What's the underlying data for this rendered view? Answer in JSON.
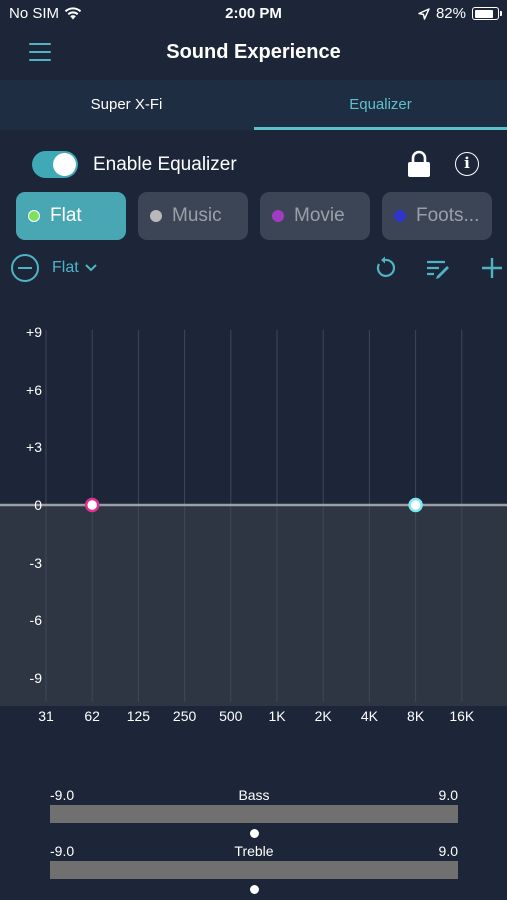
{
  "status_bar": {
    "carrier": "No SIM",
    "time": "2:00 PM",
    "battery_percent_text": "82%",
    "battery_level": 0.82,
    "icons": [
      "wifi-icon",
      "location-arrow-icon",
      "battery-icon"
    ]
  },
  "nav": {
    "title": "Sound Experience",
    "menu_icon": "hamburger-menu-icon"
  },
  "tabs": [
    {
      "label": "Super X-Fi",
      "active": false
    },
    {
      "label": "Equalizer",
      "active": true
    }
  ],
  "equalizer": {
    "enable_label": "Enable Equalizer",
    "enabled": true,
    "lock_icon": "lock-icon",
    "info_icon": "info-icon"
  },
  "presets": [
    {
      "label": "Flat",
      "dot_color": "#7ee05c",
      "active": true
    },
    {
      "label": "Music",
      "dot_color": "#b9b9b9",
      "active": false
    },
    {
      "label": "Movie",
      "dot_color": "#a23bc4",
      "active": false
    },
    {
      "label": "Foots...",
      "dot_color": "#2f35c9",
      "active": false
    }
  ],
  "toolbar": {
    "selected_preset": "Flat",
    "icons": [
      "minus-circle-icon",
      "chevron-down-icon",
      "reset-icon",
      "edit-list-icon",
      "plus-icon"
    ]
  },
  "eq_chart": {
    "db_labels": [
      "+9",
      "+6",
      "+3",
      "0",
      "-3",
      "-6",
      "-9"
    ],
    "frequencies": [
      "31",
      "62",
      "125",
      "250",
      "500",
      "1K",
      "2K",
      "4K",
      "8K",
      "16K"
    ],
    "band_gains_db": [
      0,
      0,
      0,
      0,
      0,
      0,
      0,
      0,
      0,
      0
    ],
    "markers": [
      {
        "band": "62",
        "gain_db": 0,
        "color": "#e0308f"
      },
      {
        "band": "8K",
        "gain_db": 0,
        "color": "#7ee8ef"
      }
    ],
    "ylim": [
      -9,
      9
    ]
  },
  "bass": {
    "label": "Bass",
    "min": "-9.0",
    "max": "9.0",
    "value": 0
  },
  "treble": {
    "label": "Treble",
    "min": "-9.0",
    "max": "9.0",
    "value": 0
  },
  "colors": {
    "accent": "#4fb3c3",
    "background": "#1c2638",
    "tab_bar": "#1f2d42",
    "preset_active": "#49a7b3",
    "preset_inactive": "#3b4555"
  }
}
